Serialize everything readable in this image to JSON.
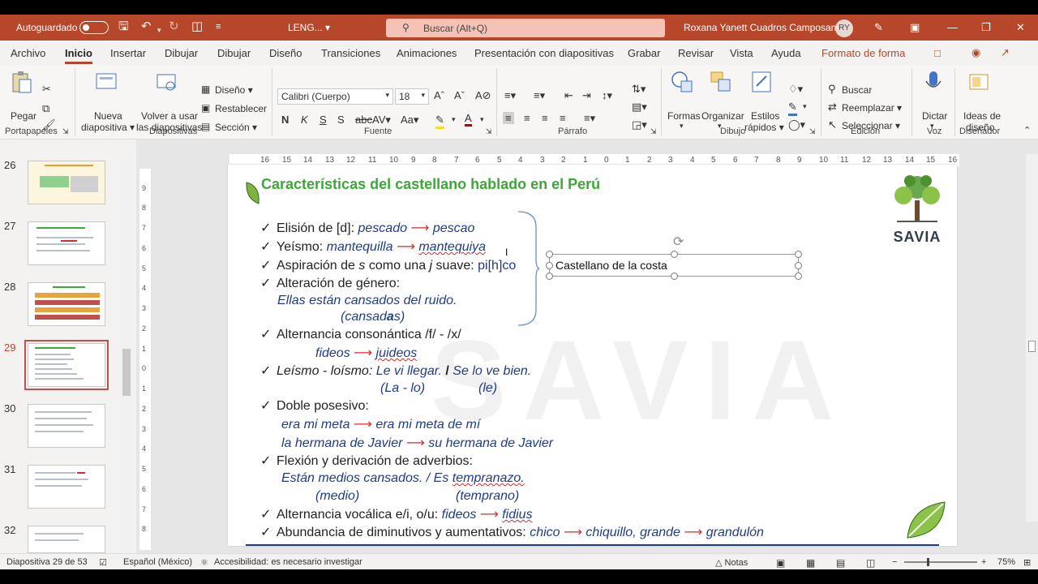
{
  "titlebar": {
    "autosave_label": "Autoguardado",
    "doc_name": "LENG...",
    "search_placeholder": "Buscar (Alt+Q)",
    "user_name": "Roxana Yanett Cuadros Camposano",
    "user_initials": "RY"
  },
  "tabs": [
    "Archivo",
    "Inicio",
    "Insertar",
    "Dibujar",
    "Dibujar",
    "Diseño",
    "Transiciones",
    "Animaciones",
    "Presentación con diapositivas",
    "Grabar",
    "Revisar",
    "Vista",
    "Ayuda",
    "Formato de forma"
  ],
  "ribbon": {
    "paste": "Pegar",
    "new_slide_1": "Nueva",
    "new_slide_2": "diapositiva",
    "reuse_1": "Volver a usar",
    "reuse_2": "las diapositivas",
    "layout": "Diseño",
    "reset": "Restablecer",
    "section": "Sección",
    "font_name": "Calibri (Cuerpo)",
    "font_size": "18",
    "shapes": "Formas",
    "arrange": "Organizar",
    "quick_styles_1": "Estilos",
    "quick_styles_2": "rápidos",
    "find": "Buscar",
    "replace": "Reemplazar",
    "select": "Seleccionar",
    "dictate": "Dictar",
    "design_ideas_1": "Ideas de",
    "design_ideas_2": "diseño",
    "groups": {
      "clipboard": "Portapapeles",
      "slides": "Diapositivas",
      "font": "Fuente",
      "paragraph": "Párrafo",
      "drawing": "Dibujo",
      "editing": "Edición",
      "voice": "Voz",
      "designer": "Diseñador"
    }
  },
  "thumbnails": [
    "26",
    "27",
    "28",
    "29",
    "30",
    "31",
    "32"
  ],
  "selected_slide": "29",
  "ruler_h": [
    "16",
    "15",
    "14",
    "13",
    "12",
    "11",
    "10",
    "9",
    "8",
    "7",
    "6",
    "5",
    "4",
    "3",
    "2",
    "1",
    "0",
    "1",
    "2",
    "3",
    "4",
    "5",
    "6",
    "7",
    "8",
    "9",
    "10",
    "11",
    "12",
    "13",
    "14",
    "15",
    "16"
  ],
  "ruler_v": [
    "9",
    "8",
    "7",
    "6",
    "5",
    "4",
    "3",
    "2",
    "1",
    "0",
    "1",
    "2",
    "3",
    "4",
    "5",
    "6",
    "7",
    "8"
  ],
  "slide": {
    "title": "Características del castellano hablado en el Perú",
    "logo_text": "SAVIA",
    "watermark": "SAVIA",
    "textbox_label": "Castellano de la costa",
    "lines": {
      "l1a": "Elisión de [d]: ",
      "l1b": "pescado",
      "l1c": "pescao",
      "l2a": "Yeísmo: ",
      "l2b": "mantequilla",
      "l2c": "mantequiya",
      "l3a": "Aspiración de ",
      "l3b": "s",
      "l3c": " como una ",
      "l3d": "j",
      "l3e": " suave: ",
      "l3f": "pi[h]co",
      "l4a": "Alteración de género:",
      "l5": "Ellas están cansados del ruido.",
      "l6a": "(cansad",
      "l6b": "a",
      "l6c": "s)",
      "l7": "Alternancia consonántica /f/ - /x/",
      "l8a": "fideos",
      "l8b": "juideos",
      "l9a": "Leísmo - loísmo:  ",
      "l9b": "Le vi llegar.",
      "l9c": "Se lo ve bien.",
      "l10a": "(La - lo)",
      "l10b": "(le)",
      "l11": "Doble posesivo:",
      "l12a": "era mi meta",
      "l12b": "era mi meta de mí",
      "l13a": "la hermana de Javier",
      "l13b": "su hermana de Javier",
      "l14": "Flexión y derivación de adverbios:",
      "l15a": "Están medios cansados.",
      "l15b": " / Es ",
      "l15c": "tempranazo.",
      "l16a": "(medio)",
      "l16b": "(temprano)",
      "l17a": "Alternancia vocálica e/i, o/u: ",
      "l17b": "fideos",
      "l17c": "fidius",
      "l18a": "Abundancia de diminutivos y aumentativos: ",
      "l18b": "chico",
      "l18c": "chiquillo, grande",
      "l18d": "grandulón"
    }
  },
  "status": {
    "slide_of": "Diapositiva 29 de 53",
    "language": "Español (México)",
    "accessibility": "Accesibilidad: es necesario investigar",
    "notes": "Notas",
    "zoom": "75%"
  },
  "colors": {
    "brand": "#b7472a",
    "title_green": "#3aa935",
    "italic_blue": "#1f3c88",
    "arrow_red": "#d92b2b"
  }
}
